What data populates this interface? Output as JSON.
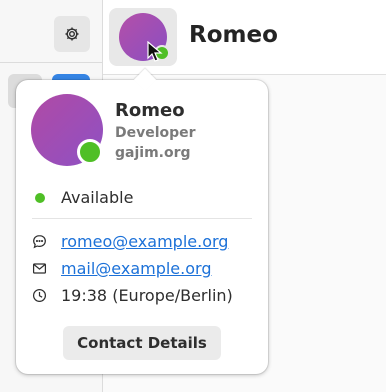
{
  "chat": {
    "title": "Romeo"
  },
  "popover": {
    "name": "Romeo",
    "role": "Developer",
    "domain": "gajim.org",
    "status": "Available",
    "xmpp_address": "romeo@example.org",
    "email": "mail@example.org",
    "local_time": "19:38 (Europe/Berlin)",
    "contact_details_label": "Contact Details"
  },
  "icons": {
    "settings": "gear-icon",
    "chat_address": "speech-bubble-icon",
    "email": "envelope-icon",
    "time": "clock-icon"
  },
  "colors": {
    "status_available": "#4fbf26",
    "link": "#1c71d8",
    "accent": "#3584e4",
    "avatar_gradient_start": "#b04aa5",
    "avatar_gradient_end": "#8e51c4"
  }
}
